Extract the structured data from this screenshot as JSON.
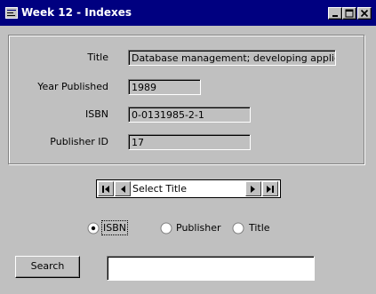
{
  "window": {
    "title": "Week 12 - Indexes",
    "icons": {
      "app": "form-icon",
      "minimize": "minimize-icon",
      "maximize": "maximize-icon",
      "close": "close-icon"
    }
  },
  "fields": {
    "title": {
      "label": "Title",
      "value": "Database management; developing application"
    },
    "year": {
      "label": "Year Published",
      "value": "1989"
    },
    "isbn": {
      "label": "ISBN",
      "value": "0-0131985-2-1"
    },
    "publisher": {
      "label": "Publisher ID",
      "value": "17"
    }
  },
  "navigator": {
    "caption": "Select Title",
    "icons": {
      "first": "first-record-icon",
      "prev": "previous-record-icon",
      "next": "next-record-icon",
      "last": "last-record-icon"
    }
  },
  "index_options": [
    {
      "label": "ISBN",
      "selected": true
    },
    {
      "label": "Publisher",
      "selected": false
    },
    {
      "label": "Title",
      "selected": false
    }
  ],
  "search": {
    "button_label": "Search",
    "value": ""
  },
  "colors": {
    "title_bar": "#000080",
    "face": "#c0c0c0"
  }
}
